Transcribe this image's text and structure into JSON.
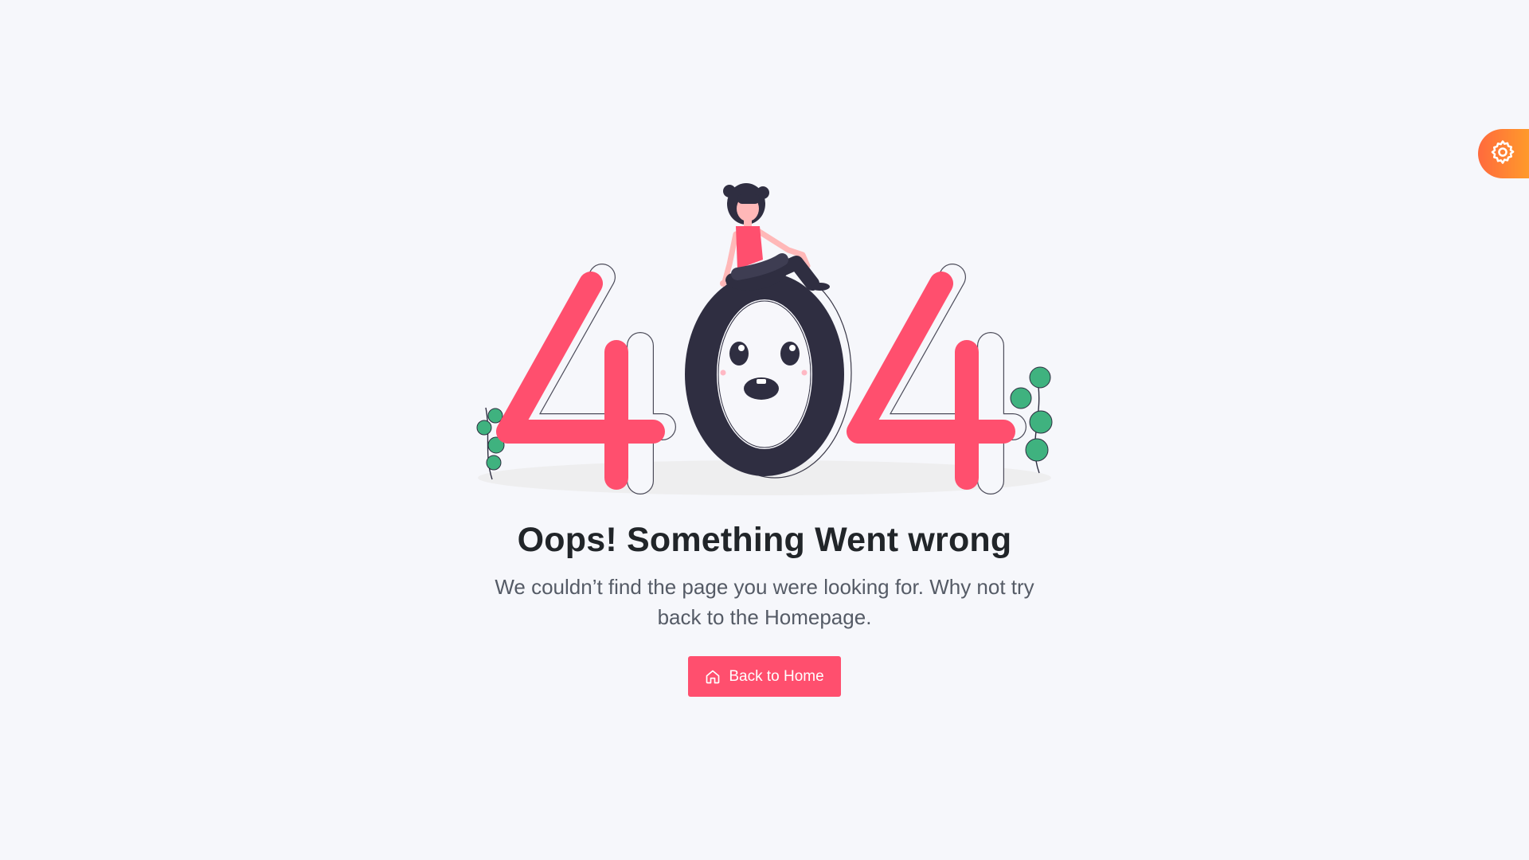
{
  "error": {
    "title": "Oops! Something Went wrong",
    "message": "We couldn’t find the page you were looking for. Why not try back to the Homepage.",
    "button_label": "Back to Home",
    "button_icon": "home-icon",
    "illustration_text": "404"
  },
  "settings": {
    "icon": "gear-icon"
  },
  "colors": {
    "background": "#f6f7fb",
    "accent": "#ff4f6e",
    "dark": "#2f2e41",
    "leaf": "#3fb27f",
    "settings_gradient_start": "#ff6a3d",
    "settings_gradient_end": "#ff9a2b"
  }
}
